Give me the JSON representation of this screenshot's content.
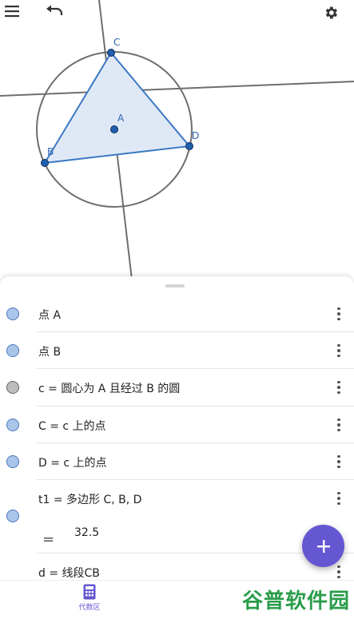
{
  "canvas": {
    "points": [
      {
        "name": "C",
        "label": "C"
      },
      {
        "name": "A",
        "label": "A"
      },
      {
        "name": "B",
        "label": "B"
      },
      {
        "name": "D",
        "label": "D"
      }
    ]
  },
  "toolbar": {
    "menu_icon": "menu-icon",
    "undo_icon": "undo-icon",
    "settings_icon": "gear-icon"
  },
  "algebra": {
    "items": [
      {
        "text": "点 A",
        "marble": "blue"
      },
      {
        "text": "点 B",
        "marble": "blue"
      },
      {
        "text": "c = 圆心为 A 且经过 B 的圆",
        "marble": "gray"
      },
      {
        "text": "C = c 上的点",
        "marble": "blue"
      },
      {
        "text": "D = c 上的点",
        "marble": "blue"
      },
      {
        "text": "t1 = 多边形 C, B, D",
        "marble": "blue",
        "value_symbol": "=",
        "value": "32.5"
      },
      {
        "text": "d = 线段CB",
        "marble": "none"
      }
    ]
  },
  "fab": {
    "icon": "plus-icon"
  },
  "bottom_nav": {
    "algebra_label": "代数区",
    "algebra_icon": "calculator-icon"
  },
  "watermark": {
    "text": "谷普软件园"
  },
  "colors": {
    "accent": "#6557d2",
    "polygon_stroke": "#3b78c4",
    "polygon_fill": "#dfe9f6",
    "point": "#1f5fae"
  }
}
